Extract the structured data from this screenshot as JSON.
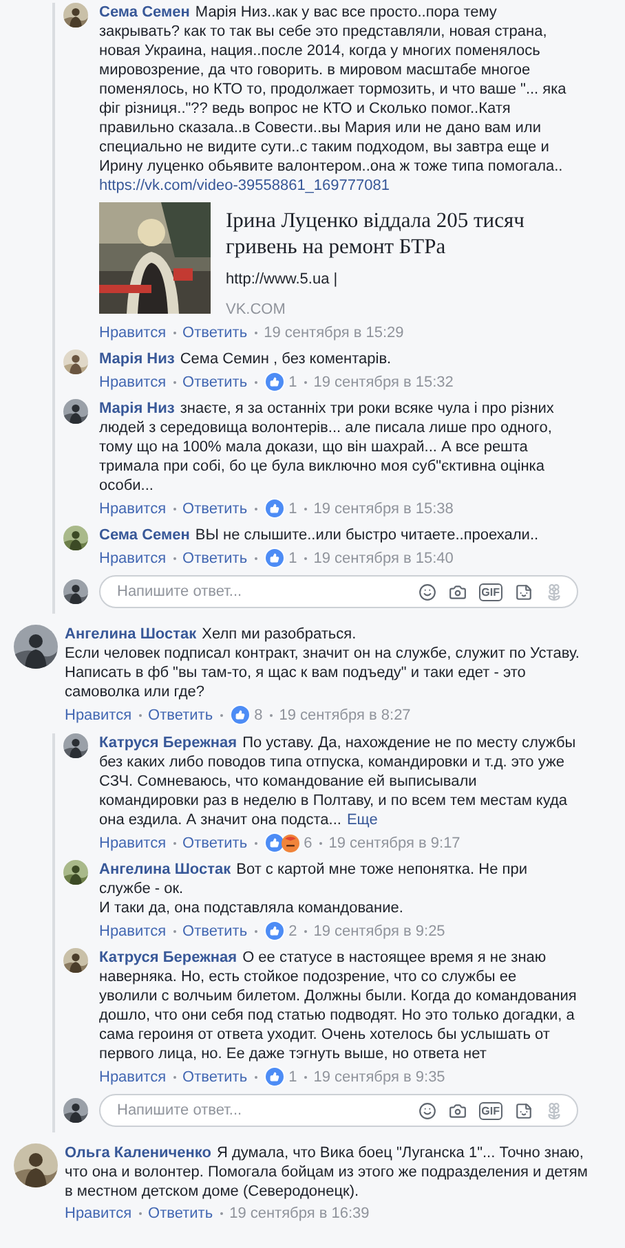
{
  "feed": [
    {
      "kind": "replies",
      "replies": [
        {
          "author": "Сема Семен",
          "text": "Марія Низ..как у вас все просто..пора тему закрывать? как то так вы себе это представляли, новая страна, новая Украина, нация..после 2014, когда у многих поменялось мировозрение, да что говорить. в мировом масштабе многое поменялось, но КТО то, продолжает тормозить, и что ваше \"... яка фіг різниця..\"?? ведь вопрос не КТО и Сколько помог..Катя правильно сказала..в Совести..вы Мария или не дано вам или специально не видите сути..с таким подходом, вы завтра еще и Ирину луценко обьявите валонтером..она ж тоже типа помогала..",
          "link": "https://vk.com/video-39558861_169777081",
          "preview": {
            "title": "Ірина Луценко віддала 205 тисяч гривень на ремонт БТРа",
            "url": "http://www.5.ua |",
            "source": "VK.COM"
          },
          "like": "Нравится",
          "reply": "Ответить",
          "time": "19 сентября в 15:29"
        },
        {
          "author": "Марія Низ",
          "text": "Сема Семин , без коментарів.",
          "like": "Нравится",
          "reply": "Ответить",
          "like_reaction": true,
          "count": "1",
          "time": "19 сентября в 15:32"
        },
        {
          "author": "Марія Низ",
          "text": "знаєте, я за останніх три роки всяке чула і про різних людей з середовища волонтерів... але писала лише про одного, тому що на 100% мала докази, що він шахрай... А все решта тримала при собі, бо це була виключно моя суб\"єктивна оцінка особи...",
          "like": "Нравится",
          "reply": "Ответить",
          "like_reaction": true,
          "count": "1",
          "time": "19 сентября в 15:38"
        },
        {
          "author": "Сема Семен",
          "text": "ВЫ не слышите..или быстро читаете..проехали..",
          "like": "Нравится",
          "reply": "Ответить",
          "like_reaction": true,
          "count": "1",
          "time": "19 сентября в 15:40"
        }
      ],
      "reply_box": {
        "placeholder": "Напишите ответ...",
        "gif": "GIF"
      }
    },
    {
      "kind": "comment",
      "author": "Ангелина Шостак",
      "text": "Хелп ми разобраться.\nЕсли человек подписал контракт, значит он на службе, служит по Уставу. Написать в фб \"вы там-то, я щас к вам подъеду\" и таки едет - это самоволка или где?",
      "like": "Нравится",
      "reply": "Ответить",
      "like_reaction": true,
      "count": "8",
      "time": "19 сентября в 8:27"
    },
    {
      "kind": "replies",
      "replies": [
        {
          "author": "Катруся Бережная",
          "text": "По уставу. Да, нахождение не по месту службы без каких либо поводов типа отпуска, командировки и т.д. это уже СЗЧ. Сомневаюсь, что командование ей выписывали командировки раз в неделю в Полтаву, и по всем тем местам куда она ездила. А значит она подста...",
          "more": "Еще",
          "like": "Нравится",
          "reply": "Ответить",
          "like_reaction": true,
          "angry_reaction": true,
          "count": "6",
          "time": "19 сентября в 9:17"
        },
        {
          "author": "Ангелина Шостак",
          "text": "Вот с картой мне тоже непонятка. Не при службе - ок.\nИ таки да, она подставляла командование.",
          "like": "Нравится",
          "reply": "Ответить",
          "like_reaction": true,
          "count": "2",
          "time": "19 сентября в 9:25"
        },
        {
          "author": "Катруся Бережная",
          "text": "О ее статусе в настоящее время я не знаю наверняка. Но, есть стойкое подозрение, что со службы ее уволили с волчьим билетом. Должны были. Когда до командования дошло, что они себя под статью подводят. Но это только догадки, а сама героиня от ответа уходит. Очень хотелось бы услышать от первого лица, но. Ее даже тэгнуть выше, но ответа нет",
          "like": "Нравится",
          "reply": "Ответить",
          "like_reaction": true,
          "count": "1",
          "time": "19 сентября в 9:35"
        }
      ],
      "reply_box": {
        "placeholder": "Напишите ответ...",
        "gif": "GIF"
      }
    },
    {
      "kind": "comment",
      "author": "Ольга Калениченко",
      "text": "Я думала, что Вика боец \"Луганска 1\"... Точно знаю, что она и волонтер. Помогала бойцам из этого же подразделения и детям в местном детском доме (Северодонецк).",
      "like": "Нравится",
      "reply": "Ответить",
      "time": "19 сентября в 16:39"
    }
  ]
}
